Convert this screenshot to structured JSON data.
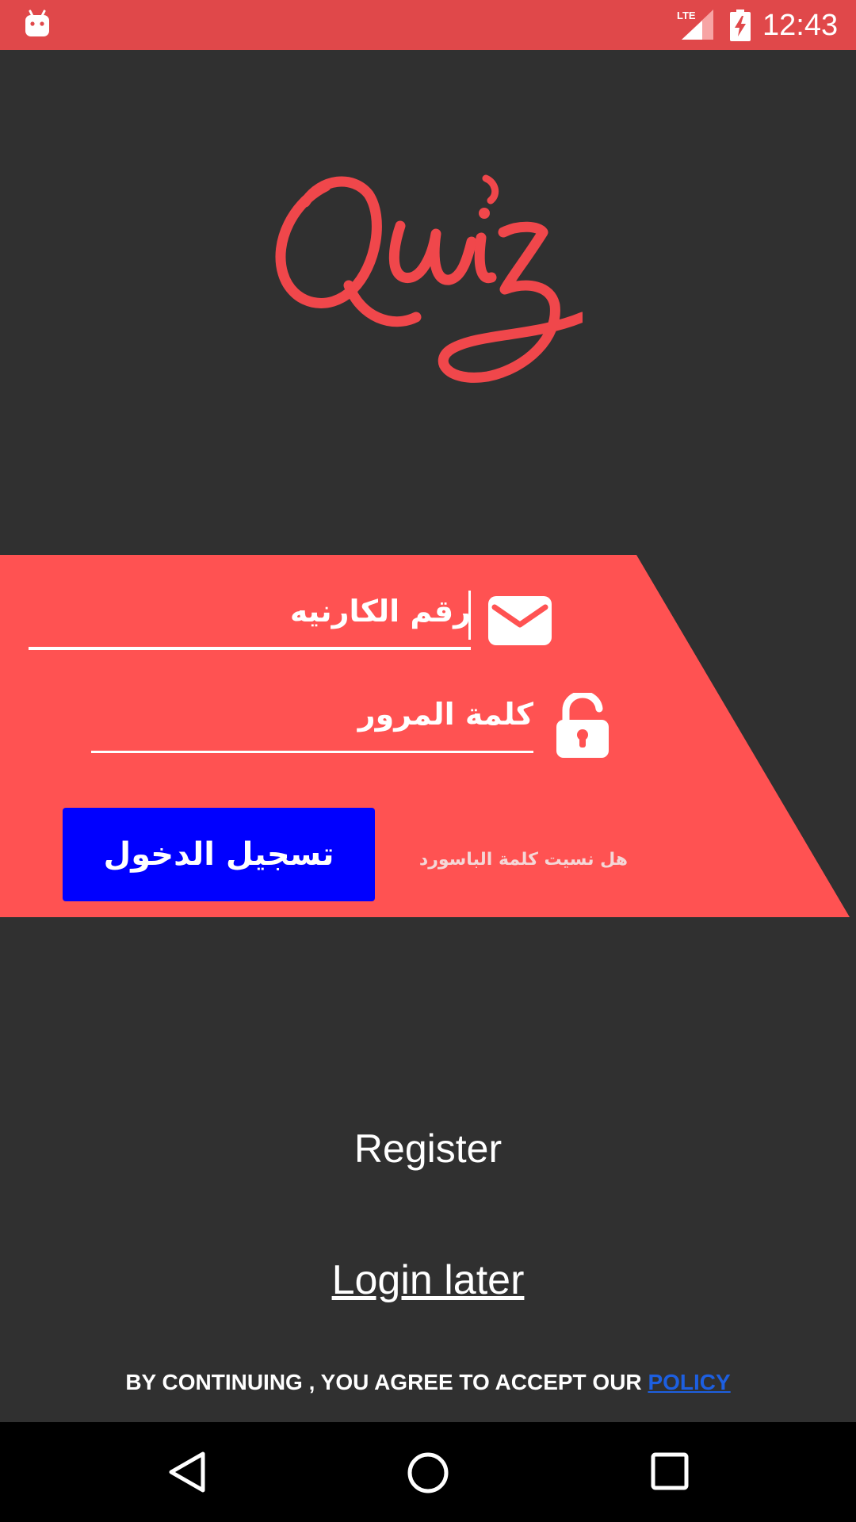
{
  "status_bar": {
    "time": "12:43",
    "network": "LTE"
  },
  "logo": {
    "text": "Quiz",
    "color": "#f0474b"
  },
  "form": {
    "username_value": "رقم الكارنيه",
    "password_value": "كلمة المرور",
    "login_button_label": "تسجيل الدخول",
    "forgot_password_label": "هل نسيت كلمة الباسورد",
    "panel_color": "#ff5252",
    "button_color": "#0000ff"
  },
  "register_label": "Register",
  "login_later_label": "Login later",
  "policy": {
    "prefix": "BY CONTINUING , YOU AGREE TO ACCEPT OUR ",
    "link_label": "POLICY"
  },
  "icons": {
    "status_left": "android-icon",
    "network": "lte-signal-icon",
    "battery": "battery-charging-icon",
    "username": "mail-icon",
    "password": "unlock-icon",
    "nav": [
      "back-icon",
      "home-icon",
      "recents-icon"
    ]
  },
  "colors": {
    "background": "#303030",
    "status_bar": "#e0484a",
    "nav_bar": "#000000",
    "policy_link": "#1d5fe0"
  }
}
